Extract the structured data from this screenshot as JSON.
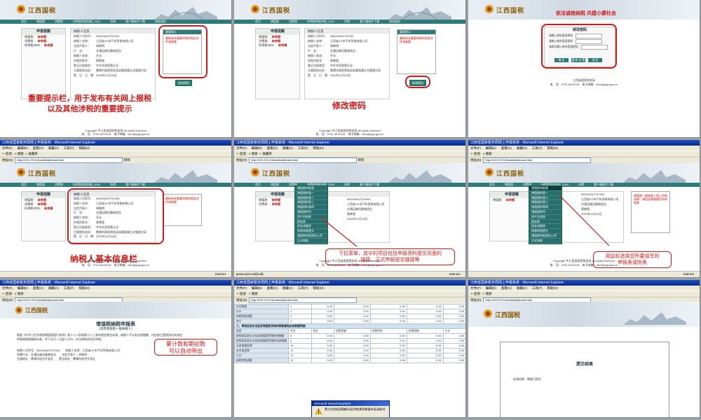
{
  "window_title": "江西省国家税务局网上申报系统 - Microsoft Internet Explorer",
  "ie": {
    "menu": [
      "文件(F)",
      "编辑(E)",
      "查看(V)",
      "收藏(A)",
      "工具(T)",
      "帮助(H)"
    ],
    "toolbar": [
      "后退",
      "搜索",
      "收藏夹",
      "媒体"
    ],
    "address_label": "地址(D)",
    "address_url": "http://220.175.5.9/publicity/brand.html",
    "go_label": "转到",
    "links_label": "链接",
    "status_internet": "Internet",
    "status_js": "javascript:void(null);",
    "status_done": "完毕"
  },
  "site": {
    "logo_text": "江西国税",
    "nav": [
      "首页",
      "增值税",
      "消费税",
      "所得税季度申报_2004",
      "所得",
      "客户端软件下载",
      "帮助服务"
    ],
    "left_panel": {
      "title": "申报提醒",
      "rows": [
        {
          "label": "增值税",
          "status": "未申报"
        },
        {
          "label": "消费税",
          "status": "未申报"
        },
        {
          "label": "所得税2004",
          "status": "未申报"
        }
      ]
    },
    "info_panel": {
      "title": "纳税人信息",
      "rows": [
        {
          "k": "纳税人识别号：",
          "v": "360203612751903"
        },
        {
          "k": "纳税人名称：",
          "v": "江西省XX市汽车贸易有限公司"
        },
        {
          "k": "法定代表人：",
          "v": "胡晓明"
        },
        {
          "k": "行　业：",
          "v": "交通运输设备制造业"
        },
        {
          "k": "纳税人状态：",
          "v": "开业"
        },
        {
          "k": "办税员姓名：",
          "v": "顾晓强"
        },
        {
          "k": "登记注册类型：",
          "v": "中外合资经营企业"
        },
        {
          "k": "主管税务机关：",
          "v": "鹰潭市国家税务局局属直属企业管理分局"
        },
        {
          "k": "登　记　日　期：",
          "v": "2002年11月18日"
        }
      ]
    },
    "notice": {
      "title": "重要提示",
      "body": "最新有关重要申报的相关文件请查看"
    },
    "pw_button": "修改密码",
    "copyright": "Copyright 中江西省国家税务局 All rights reserved",
    "contact": "电　话：0791-6223145　电子邮箱：kfzx@jxgs.gov.cn"
  },
  "captions": {
    "t1": "重要提示栏，用于发布有关网上报税\n以及其他涉税的重要提示",
    "t2": "修改密码",
    "t4": "纳税人基本信息栏",
    "t5": "下拉菜单，其中的项目包括申报资料提交页面的\n链接、正式申报提交链接等",
    "t6": "用鼠标选择您所要填写的\n申报表或附表",
    "t7": "累计数和期初数\n可以自动带出"
  },
  "dropdown_items": [
    "增值税申报表",
    "增值税附表一",
    "增值税附表二",
    "增值税附表三",
    "增值税附表四",
    "增值税附列",
    "资产负债表",
    "损益表",
    "现金流量表",
    "现税申报提交",
    "增值税申报资料上传",
    "正式申报"
  ],
  "t6_notice": "增值税一般纳税人网上申报选择：请您选择要填写的申报表",
  "password_page": {
    "slogan": "依法诚信纳税 共建小康社会",
    "title": "修改密码",
    "rows": [
      "请输入原始登录密码",
      "请输入新的登录密码",
      "请再次输入新的登录密码"
    ],
    "buttons": [
      "确 定",
      "重 新 设 置",
      "返 回"
    ],
    "bureau": "江西省国家税务局",
    "contact": "电　话：0791-6223145　电子邮箱：kfzx@jxgs.gov.cn"
  },
  "report": {
    "title": "增值税纳税申报表",
    "subtitle": "（适用增值税一般纳税人）",
    "text": "根据《中华人民共和国增值税暂行条例》第二十二条和第二十三条的规定制定本表。纳税人不论有无销售额，均应按主管税务机关核定的纳税期限填报本表，并于次月一日起十日内，向当地税务机关申报。",
    "row1": "纳税人识别号：360203612751903　　纳税人名称：江西省XX市汽车贸易有限公司",
    "row2": "所属行业：交通运输设备制造业　　法定代表人：胡晓明",
    "row3": "注册地址：鹰潭市经济开发区　　营业地址：鹰潭市经济开发区"
  },
  "table": {
    "rows": [
      {
        "label": "本月数据",
        "n": "1",
        "v": [
          "0.00",
          "0.00",
          "0.00",
          "0.00",
          "0.00"
        ]
      },
      {
        "label": "小计",
        "n": "2",
        "v": [
          "0.00",
          "0.00",
          "0.00",
          "0.00",
          "0.00"
        ]
      },
      {
        "label": "纳税检查调整",
        "n": "3",
        "v": [
          "0.00",
          "0.00",
          "0.00",
          "0.00",
          "0.00"
        ]
      },
      {
        "label": "合计",
        "n": "4",
        "v": [
          "0.00",
          "0.00",
          "0.00",
          "0.00",
          "0.00"
        ]
      }
    ],
    "section": "二、简易征收办法征收增值税货物的销售额和应纳税额明细",
    "head": [
      "项目",
      "栏次",
      "合计",
      "应税货物",
      "应税劳务",
      "合计",
      "应税货物",
      "应税劳务",
      "小计"
    ],
    "rows2": [
      {
        "label": "按简易征收办法征收增值税货物的销售额",
        "n": "8",
        "v": [
          "0.00",
          "0.00",
          "0.00",
          "0.00",
          "0.00"
        ]
      },
      {
        "label": "按简易征收办法征收增值税货物的应纳税额",
        "n": "9",
        "v": [
          "0.00",
          "0.00",
          "0.00",
          "0.00",
          "0.00"
        ]
      },
      {
        "label": "开具普通发票",
        "n": "10",
        "v": [
          "0.00",
          "0.00",
          "0.00",
          "0.00",
          "0.00"
        ]
      },
      {
        "label": "未开具发票",
        "n": "11",
        "v": [
          "0.00",
          "0.00",
          "0.00",
          "0.00",
          "0.00"
        ]
      },
      {
        "label": "小计",
        "n": "12",
        "v": [
          "0.00",
          "0.00",
          "0.00",
          "0.00",
          "0.00"
        ]
      },
      {
        "label": "纳税检查调整",
        "n": "13",
        "v": [
          "0.00",
          "0.00",
          "0.00",
          "0.00",
          "0.00"
        ]
      }
    ],
    "dialog_title": "Microsoft Internet Explorer",
    "dialog_text": "累计应免抵退税额出现负数(期初数据有误)请核对"
  },
  "result": {
    "title": "提交结果",
    "row": "处理结果：数据已提交"
  },
  "colors": {
    "accent": "#d31818",
    "nav": "#2f7a7a"
  }
}
